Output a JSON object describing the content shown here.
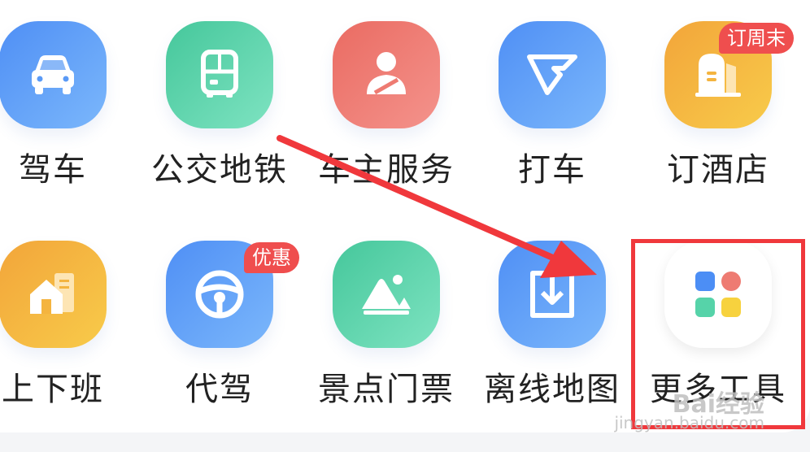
{
  "grid": {
    "row1": [
      {
        "label": "驾车",
        "icon": "car-icon",
        "color": "blue"
      },
      {
        "label": "公交地铁",
        "icon": "bus-icon",
        "color": "green"
      },
      {
        "label": "车主服务",
        "icon": "driver-user-icon",
        "color": "red"
      },
      {
        "label": "打车",
        "icon": "taxi-logo-icon",
        "color": "blue"
      },
      {
        "label": "订酒店",
        "icon": "hotel-icon",
        "color": "orange",
        "badge": "订周末"
      }
    ],
    "row2": [
      {
        "label": "上下班",
        "icon": "home-commute-icon",
        "color": "orange"
      },
      {
        "label": "代驾",
        "icon": "steering-wheel-icon",
        "color": "blue",
        "badge": "优惠"
      },
      {
        "label": "景点门票",
        "icon": "scenic-mountain-icon",
        "color": "green"
      },
      {
        "label": "离线地图",
        "icon": "download-map-icon",
        "color": "blue"
      },
      {
        "label": "更多工具",
        "icon": "more-tools-grid-icon",
        "color": "white"
      }
    ]
  },
  "colors": {
    "blue": "#5a9af6",
    "green": "#56d3a9",
    "red": "#ee7b72",
    "orange": "#f4b43f",
    "badge": "#ef4e4e",
    "highlight": "#f0383c",
    "annotation_arrow": "#f0383c"
  },
  "watermark": {
    "line1": "Bai经验",
    "line2": "jingyan.baidu.com"
  }
}
